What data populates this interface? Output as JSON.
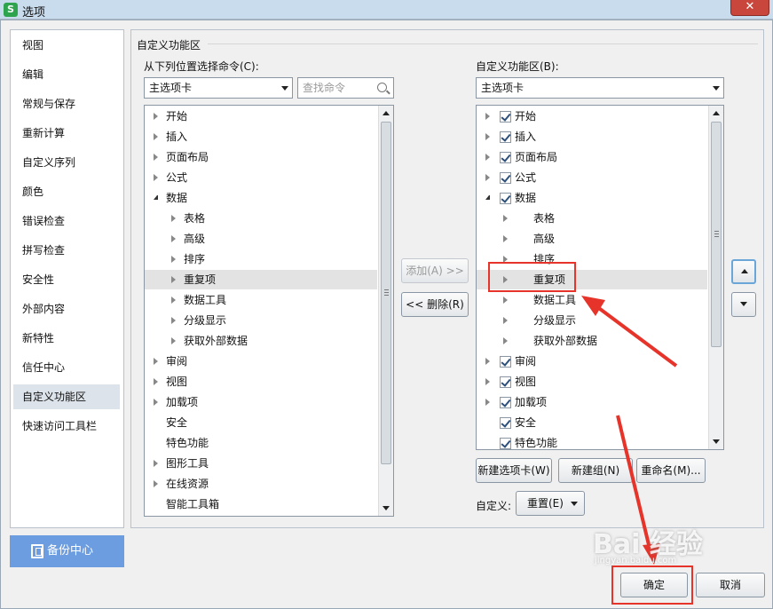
{
  "window": {
    "title": "选项",
    "app_icon": "S",
    "close": "✕"
  },
  "sidebar": {
    "items": [
      {
        "label": "视图"
      },
      {
        "label": "编辑"
      },
      {
        "label": "常规与保存"
      },
      {
        "label": "重新计算"
      },
      {
        "label": "自定义序列"
      },
      {
        "label": "颜色"
      },
      {
        "label": "错误检查"
      },
      {
        "label": "拼写检查"
      },
      {
        "label": "安全性"
      },
      {
        "label": "外部内容"
      },
      {
        "label": "新特性"
      },
      {
        "label": "信任中心"
      },
      {
        "label": "自定义功能区"
      },
      {
        "label": "快速访问工具栏"
      }
    ],
    "active_index": 12,
    "backup_label": "备份中心"
  },
  "main": {
    "group_title": "自定义功能区",
    "left": {
      "label": "从下列位置选择命令(C):",
      "select_value": "主选项卡",
      "search_placeholder": "查找命令",
      "tree": [
        {
          "label": "开始",
          "level": 0,
          "arrow": "closed"
        },
        {
          "label": "插入",
          "level": 0,
          "arrow": "closed"
        },
        {
          "label": "页面布局",
          "level": 0,
          "arrow": "closed"
        },
        {
          "label": "公式",
          "level": 0,
          "arrow": "closed"
        },
        {
          "label": "数据",
          "level": 0,
          "arrow": "open"
        },
        {
          "label": "表格",
          "level": 1,
          "arrow": "closed"
        },
        {
          "label": "高级",
          "level": 1,
          "arrow": "closed"
        },
        {
          "label": "排序",
          "level": 1,
          "arrow": "closed"
        },
        {
          "label": "重复项",
          "level": 1,
          "arrow": "closed",
          "selected": true
        },
        {
          "label": "数据工具",
          "level": 1,
          "arrow": "closed"
        },
        {
          "label": "分级显示",
          "level": 1,
          "arrow": "closed"
        },
        {
          "label": "获取外部数据",
          "level": 1,
          "arrow": "closed"
        },
        {
          "label": "审阅",
          "level": 0,
          "arrow": "closed"
        },
        {
          "label": "视图",
          "level": 0,
          "arrow": "closed"
        },
        {
          "label": "加载项",
          "level": 0,
          "arrow": "closed"
        },
        {
          "label": "安全",
          "level": 0,
          "arrow": "none"
        },
        {
          "label": "特色功能",
          "level": 0,
          "arrow": "none"
        },
        {
          "label": "图形工具",
          "level": 0,
          "arrow": "closed"
        },
        {
          "label": "在线资源",
          "level": 0,
          "arrow": "closed"
        },
        {
          "label": "智能工具箱",
          "level": 0,
          "arrow": "none"
        }
      ]
    },
    "middle": {
      "add_label": "添加(A) >>",
      "remove_label": "<< 删除(R)"
    },
    "right": {
      "label": "自定义功能区(B):",
      "select_value": "主选项卡",
      "tree": [
        {
          "label": "开始",
          "level": 0,
          "arrow": "closed",
          "checked": true
        },
        {
          "label": "插入",
          "level": 0,
          "arrow": "closed",
          "checked": true
        },
        {
          "label": "页面布局",
          "level": 0,
          "arrow": "closed",
          "checked": true
        },
        {
          "label": "公式",
          "level": 0,
          "arrow": "closed",
          "checked": true
        },
        {
          "label": "数据",
          "level": 0,
          "arrow": "open",
          "checked": true
        },
        {
          "label": "表格",
          "level": 1,
          "arrow": "closed"
        },
        {
          "label": "高级",
          "level": 1,
          "arrow": "closed"
        },
        {
          "label": "排序",
          "level": 1,
          "arrow": "closed"
        },
        {
          "label": "重复项",
          "level": 1,
          "arrow": "closed",
          "selected": true
        },
        {
          "label": "数据工具",
          "level": 1,
          "arrow": "closed"
        },
        {
          "label": "分级显示",
          "level": 1,
          "arrow": "closed"
        },
        {
          "label": "获取外部数据",
          "level": 1,
          "arrow": "closed"
        },
        {
          "label": "审阅",
          "level": 0,
          "arrow": "closed",
          "checked": true
        },
        {
          "label": "视图",
          "level": 0,
          "arrow": "closed",
          "checked": true
        },
        {
          "label": "加载项",
          "level": 0,
          "arrow": "closed",
          "checked": true
        },
        {
          "label": "安全",
          "level": 0,
          "arrow": "none",
          "checked": true
        },
        {
          "label": "特色功能",
          "level": 0,
          "arrow": "none",
          "checked": true
        }
      ],
      "new_tab_label": "新建选项卡(W)",
      "new_group_label": "新建组(N)",
      "rename_label": "重命名(M)...",
      "custom_label": "自定义:",
      "reset_label": "重置(E)"
    }
  },
  "footer": {
    "ok_label": "确定",
    "cancel_label": "取消"
  },
  "watermark": {
    "text": "Bai 经验",
    "sub": "jingyan.baidu.com"
  },
  "colors": {
    "annotation": "#e6342b",
    "backup_bg": "#6c9de0"
  }
}
